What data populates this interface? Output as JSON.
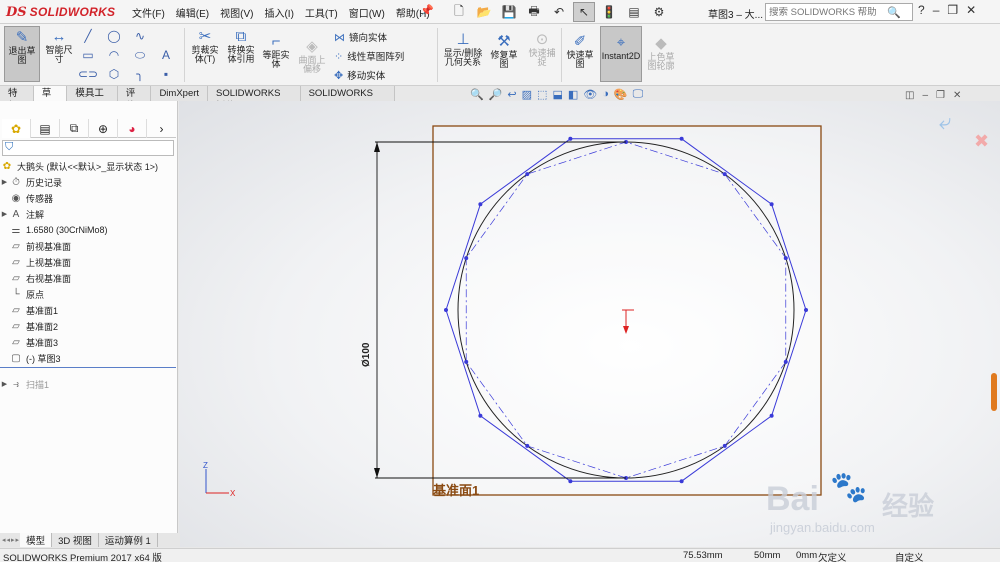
{
  "app": {
    "logo_ds": "DS",
    "logo_text": "SOLIDWORKS",
    "doc_title": "草图3 – 大...",
    "search_placeholder": "搜索 SOLIDWORKS 帮助"
  },
  "menus": [
    "文件(F)",
    "编辑(E)",
    "视图(V)",
    "插入(I)",
    "工具(T)",
    "窗口(W)",
    "帮助(H)"
  ],
  "ribbon": {
    "exit_sketch": "退出草\n图",
    "smart_dim": "智能尺\n寸",
    "trim": "剪裁实\n体(T)",
    "convert": "转换实\n体引用",
    "offset": "等距实\n体",
    "surface_offset": "曲面上\n偏移",
    "mirror": "镜向实体",
    "linear_pattern": "线性草图阵列",
    "move": "移动实体",
    "display_delete": "显示/删除\n几何关系",
    "repair": "修复草\n图",
    "quick_snap": "快速捕\n捉",
    "rapid_sketch": "快速草\n图",
    "instant2d": "Instant2D",
    "shaded_contours": "上色草\n图轮廓"
  },
  "tabs": [
    "特征",
    "草图",
    "模具工具",
    "评估",
    "DimXpert",
    "SOLIDWORKS 插件",
    "SOLIDWORKS MBD"
  ],
  "tree": {
    "root": "大鹅头  (默认<<默认>_显示状态 1>)",
    "items": [
      {
        "label": "历史记录",
        "icon": "history-icon",
        "arrow": true
      },
      {
        "label": "传感器",
        "icon": "sensor-icon",
        "arrow": false
      },
      {
        "label": "注解",
        "icon": "annotation-icon",
        "arrow": true
      },
      {
        "label": "1.6580 (30CrNiMo8)",
        "icon": "material-icon",
        "arrow": false
      },
      {
        "label": "前视基准面",
        "icon": "plane-icon",
        "arrow": false
      },
      {
        "label": "上视基准面",
        "icon": "plane-icon",
        "arrow": false
      },
      {
        "label": "右视基准面",
        "icon": "plane-icon",
        "arrow": false
      },
      {
        "label": "原点",
        "icon": "origin-icon",
        "arrow": false
      },
      {
        "label": "基准面1",
        "icon": "plane-icon",
        "arrow": false
      },
      {
        "label": "基准面2",
        "icon": "plane-icon",
        "arrow": false
      },
      {
        "label": "基准面3",
        "icon": "plane-icon",
        "arrow": false
      },
      {
        "label": "(-) 草图3",
        "icon": "sketch-icon",
        "arrow": false
      },
      {
        "label": "扫描1",
        "icon": "sweep-icon",
        "arrow": true,
        "dim": true
      }
    ]
  },
  "bottom_tabs": [
    "模型",
    "3D 视图",
    "运动算例 1"
  ],
  "status": {
    "product": "SOLIDWORKS Premium 2017 x64 版",
    "coord1": "75.53mm",
    "coord2": "50mm",
    "coord3": "0mm",
    "state": "欠定义",
    "custom": "自定义"
  },
  "viewport": {
    "plane_label": "基准面1",
    "dimension_label": "Ø100",
    "axis_z": "Z",
    "axis_x": "X"
  },
  "watermark": {
    "brand": "Bai",
    "brand_cn": "经验",
    "url": "jingyan.baidu.com"
  },
  "colors": {
    "plane_border": "#8a4a12",
    "polygon": "#3a3ad8",
    "circle": "#222222",
    "logo": "#d2232a"
  }
}
